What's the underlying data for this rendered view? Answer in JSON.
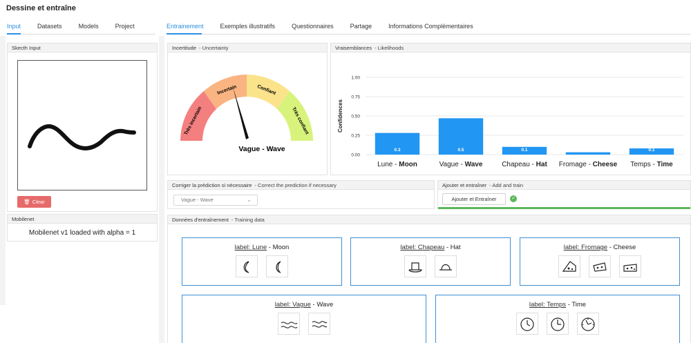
{
  "app": {
    "title": "Dessine et entraîne"
  },
  "left_tabs": [
    "Input",
    "Datasets",
    "Models",
    "Project"
  ],
  "right_tabs": [
    "Entrainement",
    "Exemples illustratifs",
    "Questionnaires",
    "Partage",
    "Informations Complémentaires"
  ],
  "sketch": {
    "title": "Skecth Input",
    "clear_label": "Clear"
  },
  "mobilenet": {
    "title": "Mobilenet",
    "message": "Mobilenet v1 loaded with alpha = 1"
  },
  "uncertainty": {
    "title": "Incertitude",
    "subtitle": "- Uncertainty",
    "segments": [
      "Très incertain",
      "Incertain",
      "Confiant",
      "Très confiant"
    ],
    "segment_colors": [
      "#f47f7f",
      "#f9b482",
      "#fbe38b",
      "#d8f37c"
    ],
    "needle_label": "Vague - Wave"
  },
  "likelihoods": {
    "title": "Vraisemblances",
    "subtitle": "- Likelihoods"
  },
  "chart_data": {
    "type": "bar",
    "ylabel": "Confidences",
    "xlabel": "",
    "ylim": [
      0,
      1.0
    ],
    "yticks": [
      "0.00",
      "0.25",
      "0.50",
      "0.75",
      "1.00"
    ],
    "categories": [
      "Lune - Moon",
      "Vague - Wave",
      "Chapeau - Hat",
      "Fromage - Cheese",
      "Temps - Time"
    ],
    "category_fr": [
      "Lune",
      "Vague",
      "Chapeau",
      "Fromage",
      "Temps"
    ],
    "category_en": [
      "Moon",
      "Wave",
      "Hat",
      "Cheese",
      "Time"
    ],
    "values": [
      0.28,
      0.47,
      0.1,
      0.03,
      0.08
    ],
    "data_labels": [
      "0.3",
      "0.5",
      "0.1",
      "",
      "0.1"
    ],
    "bar_color": "#2196f3",
    "grid": true
  },
  "correct": {
    "title": "Corriger la prédiction si nécessaire",
    "subtitle": "- Correct the prediction if necessary",
    "selected": "Vague - Wave"
  },
  "add_train": {
    "title": "Ajouter et entraîner",
    "subtitle": "- Add and train",
    "button": "Ajouter et Entraîner"
  },
  "training_data": {
    "title": "Données d'entraînement",
    "subtitle": "- Training data",
    "cards": [
      {
        "prefix": "label: Lune",
        "suffix": " - Moon",
        "icons": [
          "moon-sketch-icon",
          "moon-sketch-icon"
        ]
      },
      {
        "prefix": "label: Chapeau",
        "suffix": " - Hat",
        "icons": [
          "hat-sketch-icon",
          "hat-sketch-icon"
        ]
      },
      {
        "prefix": "label: Fromage",
        "suffix": " - Cheese",
        "icons": [
          "cheese-sketch-icon",
          "cheese-sketch-icon",
          "cheese-sketch-icon"
        ]
      },
      {
        "prefix": "label: Vague",
        "suffix": " - Wave",
        "icons": [
          "wave-sketch-icon",
          "wave-sketch-icon"
        ]
      },
      {
        "prefix": "label: Temps",
        "suffix": " - Time",
        "icons": [
          "clock-sketch-icon",
          "clock-sketch-icon",
          "clock-sketch-icon"
        ]
      }
    ]
  }
}
